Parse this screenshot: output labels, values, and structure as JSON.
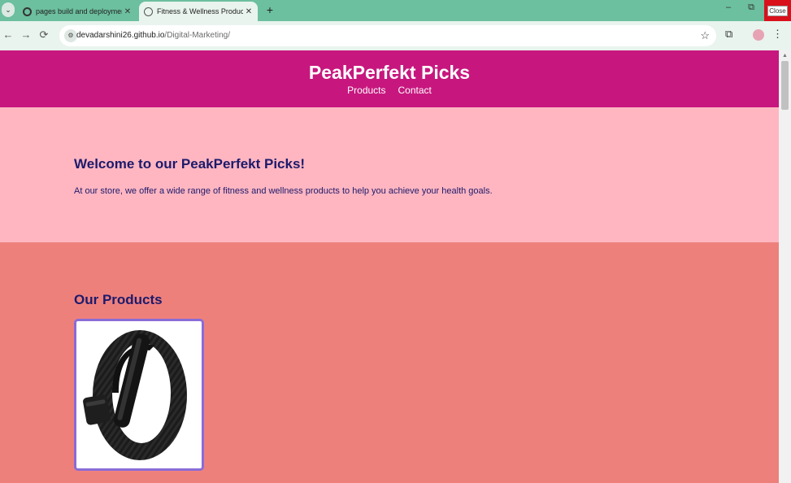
{
  "browser": {
    "tabs": [
      {
        "title": "pages build and deployment ·",
        "active": false,
        "icon": "github-icon"
      },
      {
        "title": "Fitness & Wellness Products",
        "active": true,
        "icon": "globe-icon"
      }
    ],
    "new_tab": "+",
    "window": {
      "minimize": "–",
      "restore": "⧉",
      "close_label": "Close"
    },
    "nav": {
      "back": "←",
      "forward": "→",
      "reload": "⟳",
      "star": "☆",
      "extensions": "⧉",
      "menu": "⋮"
    },
    "url": {
      "host": "devadarshini26.github.io",
      "path": "/Digital-Marketing/"
    }
  },
  "site": {
    "title": "PeakPerfekt Picks",
    "nav": [
      "Products",
      "Contact"
    ],
    "hero": {
      "heading": "Welcome to our PeakPerfekt Picks!",
      "text": "At our store, we offer a wide range of fitness and wellness products to help you achieve your health goals."
    },
    "products": {
      "heading": "Our Products",
      "items": [
        {
          "image": "black-fitness-band"
        }
      ]
    }
  },
  "colors": {
    "header": "#c7177e",
    "hero_bg": "#ffb6c1",
    "products_bg": "#ee807c",
    "heading_text": "#1c1a6b",
    "card_border": "#8a6cd6"
  }
}
